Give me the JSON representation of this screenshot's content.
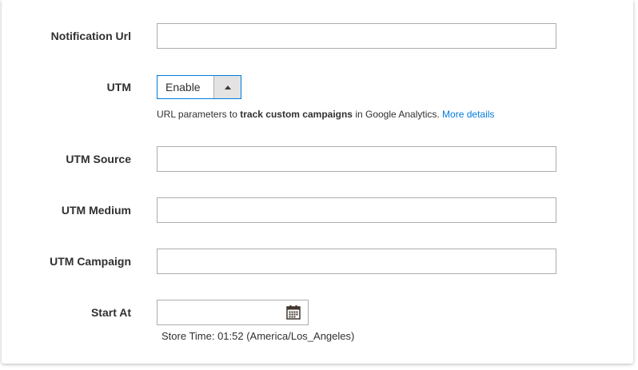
{
  "form": {
    "notification_url": {
      "label": "Notification Url",
      "value": ""
    },
    "utm": {
      "label": "UTM",
      "selected": "Enable",
      "note": {
        "prefix": "URL parameters to ",
        "bold": "track custom campaigns",
        "middle": " in Google Analytics. ",
        "link": "More details"
      }
    },
    "utm_source": {
      "label": "UTM Source",
      "value": ""
    },
    "utm_medium": {
      "label": "UTM Medium",
      "value": ""
    },
    "utm_campaign": {
      "label": "UTM Campaign",
      "value": ""
    },
    "start_at": {
      "label": "Start At",
      "value": "",
      "store_time": "Store Time: 01:52 (America/Los_Angeles)"
    }
  },
  "colors": {
    "link": "#007bdb",
    "focus_border": "#007bdb",
    "field_border": "#adadad",
    "text": "#303030"
  },
  "icons": {
    "dropdown": "caret-up-icon",
    "date_picker": "calendar-icon"
  }
}
